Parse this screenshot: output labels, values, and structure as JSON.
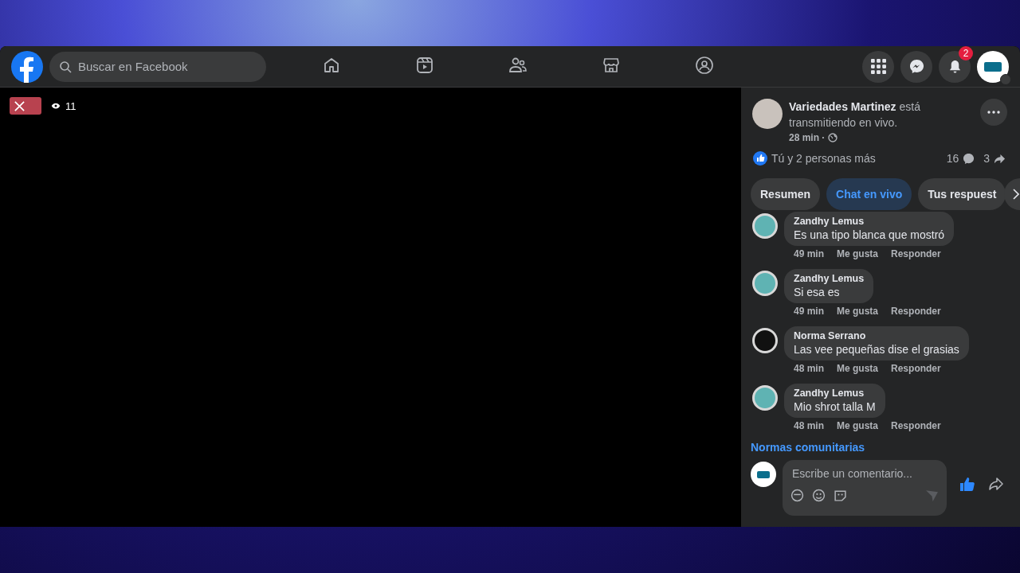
{
  "topbar": {
    "search": {
      "placeholder": "Buscar en Facebook"
    },
    "nav": [
      {
        "kind": "home",
        "selected": false
      },
      {
        "kind": "video",
        "selected": false
      },
      {
        "kind": "friends",
        "selected": false
      },
      {
        "kind": "market",
        "selected": false
      },
      {
        "kind": "groups",
        "selected": false
      }
    ],
    "notifications": "2"
  },
  "video": {
    "viewers": "11"
  },
  "post": {
    "author": "Variedades Martinez",
    "status": "está transmitiendo en vivo.",
    "time": "28 min ·",
    "reactions": "Tú y 2 personas más",
    "comments": "16",
    "shares": "3"
  },
  "tabs": [
    {
      "label": "Resumen",
      "selected": false
    },
    {
      "label": "Chat en vivo",
      "selected": true
    },
    {
      "label": "Tus respuest",
      "selected": false
    }
  ],
  "comments": [
    {
      "author": "Zandhy Lemus",
      "text": "Es una tipo blanca que mostró",
      "time": "49 min",
      "like": "Me gusta",
      "reply": "Responder",
      "color": "#5fb3b3"
    },
    {
      "author": "Zandhy Lemus",
      "text": "Si esa es",
      "time": "49 min",
      "like": "Me gusta",
      "reply": "Responder",
      "color": "#5fb3b3"
    },
    {
      "author": "Norma Serrano",
      "text": "Las vee pequeñas dise el grasias",
      "time": "48 min",
      "like": "Me gusta",
      "reply": "Responder",
      "color": "#111111"
    },
    {
      "author": "Zandhy Lemus",
      "text": "Mio shrot talla M",
      "time": "48 min",
      "like": "Me gusta",
      "reply": "Responder",
      "color": "#5fb3b3"
    }
  ],
  "community_link": "Normas comunitarias",
  "composer": {
    "placeholder": "Escribe un comentario..."
  }
}
